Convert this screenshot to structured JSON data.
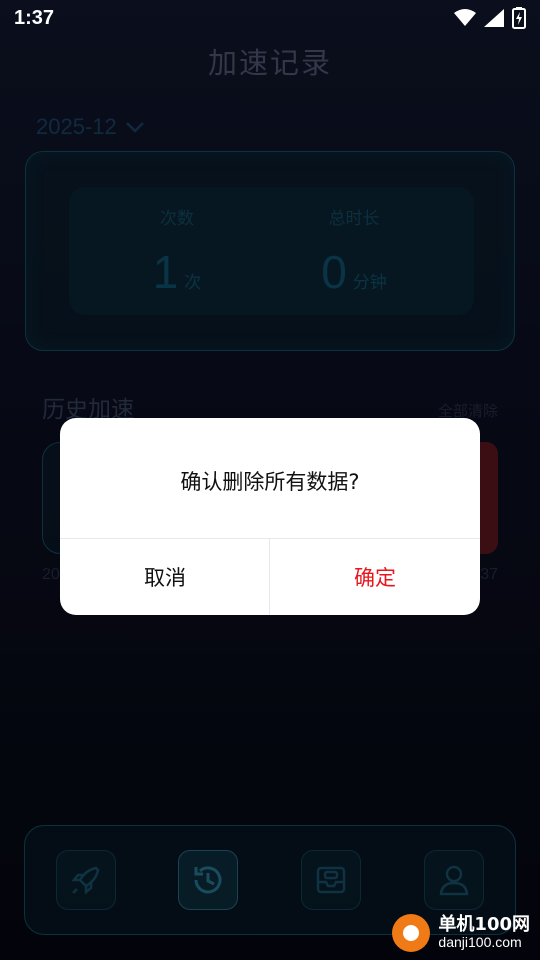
{
  "status_bar": {
    "time": "1:37",
    "wifi_icon": "wifi-icon",
    "signal_icon": "signal-icon",
    "battery_icon": "battery-charging-icon"
  },
  "page": {
    "title": "加速记录"
  },
  "month_picker": {
    "value": "2025-12",
    "icon": "chevron-down-icon"
  },
  "stats": {
    "count_label": "次数",
    "count_value": "1",
    "count_unit": "次",
    "duration_label": "总时长",
    "duration_value": "0",
    "duration_unit": "分钟"
  },
  "history": {
    "title": "历史加速",
    "clear_all": "全部清除",
    "item_date_partial": "20",
    "item_time_partial": "37"
  },
  "bottom_nav": {
    "items": [
      {
        "icon": "rocket-icon",
        "active": false
      },
      {
        "icon": "history-clock-icon",
        "active": true
      },
      {
        "icon": "inbox-tray-icon",
        "active": false
      },
      {
        "icon": "user-icon",
        "active": false
      }
    ]
  },
  "dialog": {
    "message": "确认删除所有数据?",
    "cancel_label": "取消",
    "confirm_label": "确定",
    "confirm_color": "#e8151c"
  },
  "watermark": {
    "title": "单机100网",
    "domain": "danji100.com"
  }
}
